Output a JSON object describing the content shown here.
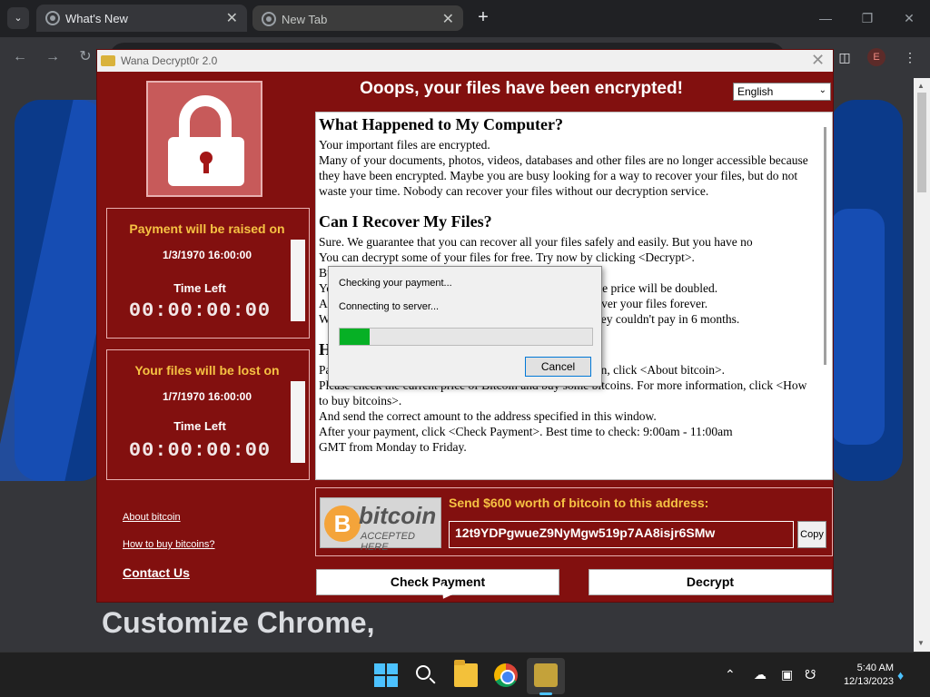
{
  "browser": {
    "tabs": [
      {
        "title": "What's New"
      },
      {
        "title": "New Tab"
      }
    ],
    "profile_initial": "E"
  },
  "page": {
    "customize_text": "Customize Chrome,"
  },
  "wana": {
    "window_title": "Wana Decrypt0r 2.0",
    "headline": "Ooops, your files have been encrypted!",
    "language": "English",
    "timer1": {
      "header": "Payment will be raised on",
      "date": "1/3/1970 16:00:00",
      "label": "Time Left",
      "countdown": "00:00:00:00"
    },
    "timer2": {
      "header": "Your files will be lost on",
      "date": "1/7/1970 16:00:00",
      "label": "Time Left",
      "countdown": "00:00:00:00"
    },
    "links": {
      "about_bitcoin": "About bitcoin",
      "how_to_buy": "How to buy bitcoins?",
      "contact_us": "Contact Us"
    },
    "text": {
      "h1": "What Happened to My Computer?",
      "p1a": "Your important files are encrypted.",
      "p1b": "Many of your documents, photos, videos, databases and other files are no longer accessible because they have been encrypted. Maybe you are busy looking for a way to recover your files, but do not waste your time. Nobody can recover your files without our decryption service.",
      "h2": "Can I Recover My Files?",
      "p2a": "Sure. We guarantee that you can recover all your files safely and easily. But you have no",
      "p2b": "You can decrypt some of your files for free. Try now by clicking <Decrypt>.",
      "p2c": "But if you want to decrypt all your files, you need to pay.",
      "p2d": "You only have 3 days to submit the payment. After that the price will be doubled.",
      "p2e": "Also, if you don't pay in 7 days, you won't be able to recover your files forever.",
      "p2f": "We will have free events for users who are so poor that they couldn't pay in 6 months.",
      "h3": "How Do I Pay?",
      "p3a": "Payment is accepted in Bitcoin only. For more information, click <About bitcoin>.",
      "p3b": "Please check the current price of Bitcoin and buy some bitcoins. For more information, click <How to buy bitcoins>.",
      "p3c": "And send the correct amount to the address specified in this window.",
      "p3d": "After your payment, click <Check Payment>. Best time to check: 9:00am - 11:00am",
      "p3e": "GMT from Monday to Friday."
    },
    "bitcoin_logo": {
      "coin": "B",
      "word": "bitcoin",
      "accepted": "ACCEPTED HERE"
    },
    "send_label": "Send $600 worth of bitcoin to this address:",
    "address": "12t9YDPgwueZ9NyMgw519p7AA8isjr6SMw",
    "copy_label": "Copy",
    "check_payment_label": "Check Payment",
    "decrypt_label": "Decrypt"
  },
  "dialog": {
    "line1": "Checking your payment...",
    "line2": "Connecting to server...",
    "progress_fraction": 0.12,
    "cancel_label": "Cancel"
  },
  "taskbar": {
    "time": "5:40 AM",
    "date": "12/13/2023"
  }
}
